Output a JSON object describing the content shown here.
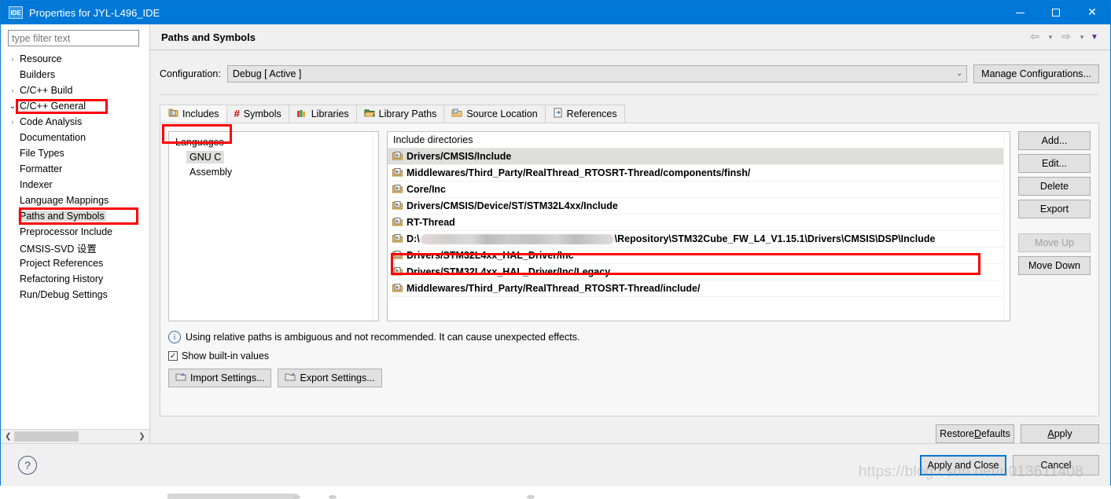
{
  "window": {
    "app_icon_text": "IDE",
    "title": "Properties for JYL-L496_IDE",
    "minimize": "—",
    "maximize": "□",
    "close": "✕"
  },
  "sidebar": {
    "filter_placeholder": "type filter text",
    "items": [
      {
        "label": "Resource",
        "level": 0,
        "arrow": "›"
      },
      {
        "label": "Builders",
        "level": 0,
        "arrow": ""
      },
      {
        "label": "C/C++ Build",
        "level": 0,
        "arrow": "›"
      },
      {
        "label": "C/C++ General",
        "level": 0,
        "arrow": "⌄"
      },
      {
        "label": "Code Analysis",
        "level": 1,
        "arrow": "›"
      },
      {
        "label": "Documentation",
        "level": 1,
        "arrow": ""
      },
      {
        "label": "File Types",
        "level": 1,
        "arrow": ""
      },
      {
        "label": "Formatter",
        "level": 1,
        "arrow": ""
      },
      {
        "label": "Indexer",
        "level": 1,
        "arrow": ""
      },
      {
        "label": "Language Mappings",
        "level": 1,
        "arrow": ""
      },
      {
        "label": "Paths and Symbols",
        "level": 1,
        "arrow": "",
        "selected": true
      },
      {
        "label": "Preprocessor Include",
        "level": 1,
        "arrow": ""
      },
      {
        "label": "CMSIS-SVD 设置",
        "level": 0,
        "arrow": ""
      },
      {
        "label": "Project References",
        "level": 0,
        "arrow": ""
      },
      {
        "label": "Refactoring History",
        "level": 0,
        "arrow": ""
      },
      {
        "label": "Run/Debug Settings",
        "level": 0,
        "arrow": ""
      }
    ],
    "scroll_left": "❮",
    "scroll_right": "❯"
  },
  "header": {
    "page_title": "Paths and Symbols",
    "nav_back": "⇦",
    "nav_back_caret": "▾",
    "nav_forward": "⇨",
    "nav_forward_caret": "▾",
    "view_menu_caret": "▼"
  },
  "configuration": {
    "label": "Configuration:",
    "value": "Debug  [ Active ]",
    "dropdown_caret": "⌄",
    "manage_button": "Manage Configurations..."
  },
  "tabs": [
    {
      "label": "Includes",
      "icon": "include-folder-icon",
      "active": true
    },
    {
      "label": "Symbols",
      "icon": "hash-icon",
      "active": false
    },
    {
      "label": "Libraries",
      "icon": "books-icon",
      "active": false
    },
    {
      "label": "Library Paths",
      "icon": "open-folder-icon",
      "active": false
    },
    {
      "label": "Source Location",
      "icon": "source-folder-icon",
      "active": false
    },
    {
      "label": "References",
      "icon": "reference-doc-icon",
      "active": false
    }
  ],
  "languages": {
    "header": "Languages",
    "items": [
      {
        "label": "GNU C",
        "selected": true
      },
      {
        "label": "Assembly",
        "selected": false
      }
    ]
  },
  "include_list": {
    "header": "Include directories",
    "rows": [
      {
        "text": "Drivers/CMSIS/Include",
        "selected": true
      },
      {
        "text": "Middlewares/Third_Party/RealThread_RTOSRT-Thread/components/finsh/",
        "selected": false
      },
      {
        "text": "Core/Inc",
        "selected": false
      },
      {
        "text": "Drivers/CMSIS/Device/ST/STM32L4xx/Include",
        "selected": false
      },
      {
        "text": "RT-Thread",
        "selected": false
      },
      {
        "prefix": "D:\\",
        "redacted": true,
        "suffix": "\\Repository\\STM32Cube_FW_L4_V1.15.1\\Drivers\\CMSIS\\DSP\\Include",
        "selected": false
      },
      {
        "text": "Drivers/STM32L4xx_HAL_Driver/Inc",
        "selected": false
      },
      {
        "text": "Drivers/STM32L4xx_HAL_Driver/Inc/Legacy",
        "selected": false
      },
      {
        "text": "Middlewares/Third_Party/RealThread_RTOSRT-Thread/include/",
        "selected": false
      }
    ]
  },
  "list_buttons": [
    {
      "label": "Add...",
      "disabled": false
    },
    {
      "label": "Edit...",
      "disabled": false
    },
    {
      "label": "Delete",
      "disabled": false
    },
    {
      "label": "Export",
      "disabled": false
    },
    {
      "label": "Move Up",
      "disabled": true
    },
    {
      "label": "Move Down",
      "disabled": false
    }
  ],
  "notice": {
    "icon": "info-icon",
    "text": "Using relative paths is ambiguous and not recommended. It can cause unexpected effects."
  },
  "show_builtin": {
    "label": "Show built-in values",
    "checked": true,
    "check_glyph": "✓"
  },
  "settings_buttons": [
    {
      "label": "Import Settings...",
      "icon": "import-icon"
    },
    {
      "label": "Export Settings...",
      "icon": "export-icon"
    }
  ],
  "apply_row": [
    {
      "label": "Restore Defaults"
    },
    {
      "label": "Apply"
    }
  ],
  "footer": {
    "help_icon": "?",
    "buttons": [
      {
        "label": "Apply and Close",
        "focused": true
      },
      {
        "label": "Cancel",
        "focused": false
      }
    ]
  },
  "watermark": "https://blog.csdn.net/u013611408",
  "annotation_color": "#ff0000"
}
